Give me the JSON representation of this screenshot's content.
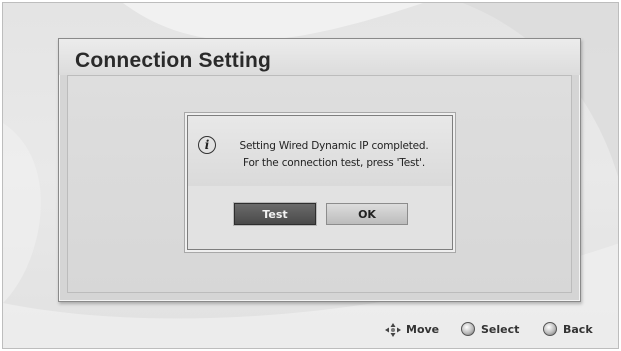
{
  "window": {
    "title": "Connection Setting"
  },
  "dialog": {
    "icon": "info-icon",
    "message_line1": "Setting Wired Dynamic IP completed.",
    "message_line2": "For the connection test, press 'Test'.",
    "buttons": {
      "test_label": "Test",
      "ok_label": "OK"
    },
    "focused_button": "Test"
  },
  "footer_hints": {
    "move_label": "Move",
    "select_label": "Select",
    "back_label": "Back",
    "move_icon": "directional-pad-icon",
    "select_icon": "select-circle-icon",
    "back_icon": "back-circle-icon"
  },
  "colors": {
    "focused_button_bg": "#5a5a5a",
    "normal_button_bg": "#cccccc",
    "window_bg": "#d5d5d5"
  }
}
